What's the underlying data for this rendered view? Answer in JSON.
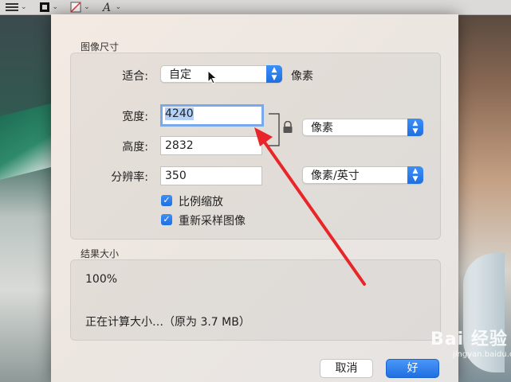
{
  "dialog": {
    "image_size_title": "图像尺寸",
    "fit_label": "适合:",
    "fit_value": "自定",
    "fit_unit": "像素",
    "width_label": "宽度:",
    "width_value": "4240",
    "height_label": "高度:",
    "height_value": "2832",
    "size_unit_value": "像素",
    "resolution_label": "分辨率:",
    "resolution_value": "350",
    "resolution_unit_value": "像素/英寸",
    "scale_checkbox_label": "比例缩放",
    "scale_checked": true,
    "resample_checkbox_label": "重新采样图像",
    "resample_checked": true,
    "result_title": "结果大小",
    "result_percent": "100%",
    "result_status": "正在计算大小…（原为 3.7 MB）",
    "cancel_label": "取消",
    "ok_label": "好"
  },
  "toolbar": {
    "icons": [
      "list-lines-icon",
      "stroke-box-icon",
      "no-fill-icon",
      "text-style-icon"
    ]
  },
  "annotation": {
    "arrow_color": "#e8262a"
  },
  "watermark": {
    "brand": "Bai 经验",
    "url": "jingyan.baidu.com"
  },
  "colors": {
    "accent": "#1f6fe0",
    "focus_ring": "#7aa8ec"
  }
}
